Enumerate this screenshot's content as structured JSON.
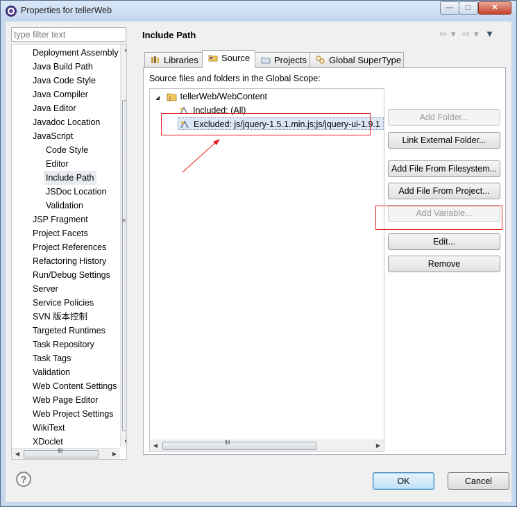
{
  "window": {
    "title": "Properties for tellerWeb"
  },
  "filter": {
    "placeholder": "type filter text"
  },
  "nav": {
    "items": [
      {
        "label": "Deployment Assembly",
        "level": 0
      },
      {
        "label": "Java Build Path",
        "level": 0
      },
      {
        "label": "Java Code Style",
        "level": 0
      },
      {
        "label": "Java Compiler",
        "level": 0
      },
      {
        "label": "Java Editor",
        "level": 0
      },
      {
        "label": "Javadoc Location",
        "level": 0
      },
      {
        "label": "JavaScript",
        "level": 0
      },
      {
        "label": "Code Style",
        "level": 1
      },
      {
        "label": "Editor",
        "level": 1
      },
      {
        "label": "Include Path",
        "level": 1,
        "selected": true
      },
      {
        "label": "JSDoc Location",
        "level": 1
      },
      {
        "label": "Validation",
        "level": 1
      },
      {
        "label": "JSP Fragment",
        "level": 0
      },
      {
        "label": "Project Facets",
        "level": 0
      },
      {
        "label": "Project References",
        "level": 0
      },
      {
        "label": "Refactoring History",
        "level": 0
      },
      {
        "label": "Run/Debug Settings",
        "level": 0
      },
      {
        "label": "Server",
        "level": 0
      },
      {
        "label": "Service Policies",
        "level": 0
      },
      {
        "label": "SVN 版本控制",
        "level": 0
      },
      {
        "label": "Targeted Runtimes",
        "level": 0
      },
      {
        "label": "Task Repository",
        "level": 0
      },
      {
        "label": "Task Tags",
        "level": 0
      },
      {
        "label": "Validation",
        "level": 0
      },
      {
        "label": "Web Content Settings",
        "level": 0
      },
      {
        "label": "Web Page Editor",
        "level": 0
      },
      {
        "label": "Web Project Settings",
        "level": 0
      },
      {
        "label": "WikiText",
        "level": 0
      },
      {
        "label": "XDoclet",
        "level": 0
      }
    ]
  },
  "page": {
    "title": "Include Path"
  },
  "tabs": [
    {
      "label": "Libraries",
      "icon": "libraries-icon"
    },
    {
      "label": "Source",
      "icon": "source-folder-icon",
      "active": true
    },
    {
      "label": "Projects",
      "icon": "projects-icon"
    },
    {
      "label": "Global SuperType",
      "icon": "global-supertype-icon"
    }
  ],
  "source": {
    "scope_label": "Source files and folders in the Global Scope:",
    "tree": {
      "root": "tellerWeb/WebContent",
      "included": "Included: (All)",
      "excluded": "Excluded: js/jquery-1.5.1.min.js;js/jquery-ui-1.9.1"
    }
  },
  "buttons": {
    "add_folder": "Add Folder...",
    "link_external_folder": "Link External Folder...",
    "add_file_from_filesystem": "Add File From Filesystem...",
    "add_file_from_project": "Add File From Project...",
    "add_variable": "Add Variable...",
    "edit": "Edit...",
    "remove": "Remove"
  },
  "dialog": {
    "ok": "OK",
    "cancel": "Cancel",
    "help": "?"
  },
  "colors": {
    "annotation_red": "#e02020",
    "selection": "#dce6f4"
  }
}
